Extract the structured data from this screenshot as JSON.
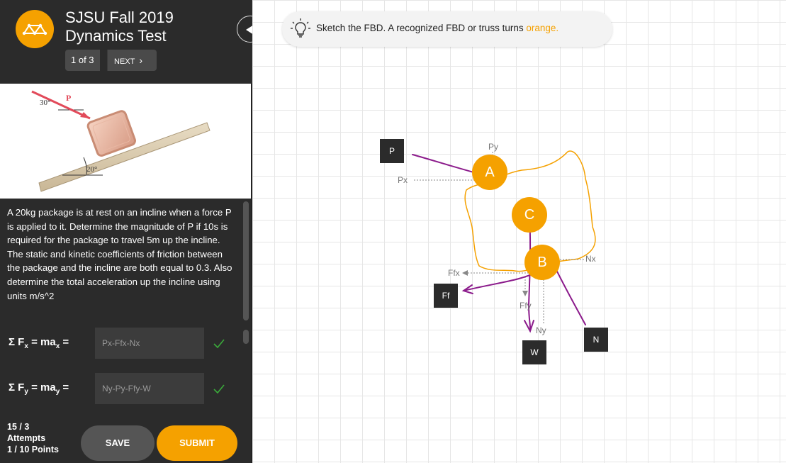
{
  "header": {
    "title_line1": "SJSU Fall 2019",
    "title_line2": "Dynamics Test",
    "pager": "1 of 3",
    "next_label": "NEXT"
  },
  "figure": {
    "angle_force": "30°",
    "force_label": "P",
    "angle_incline": "20°"
  },
  "problem": {
    "text": "A 20kg package is at rest on an incline when a force P is applied to it. Determine the magnitude of P if 10s is required for the package to travel 5m up the incline. The static and kinetic coefficients of friction between the package and the incline are both equal to 0.3. Also determine the total acceleration up the incline using units m/s^2"
  },
  "equations": [
    {
      "label_prefix": "Σ F",
      "label_sub": "x",
      "label_mid": " = ma",
      "label_sub2": "x",
      "label_suffix": " =",
      "value": "Px-Ffx-Nx"
    },
    {
      "label_prefix": "Σ F",
      "label_sub": "y",
      "label_mid": " = ma",
      "label_sub2": "y",
      "label_suffix": " =",
      "value": "Ny-Py-Ffy-W"
    }
  ],
  "footer": {
    "attempts_count": "15 / 3",
    "attempts_label": "Attempts",
    "points": "1 / 10 Points",
    "save_label": "SAVE",
    "submit_label": "SUBMIT"
  },
  "hint": {
    "text": "Sketch the FBD. A recognized FBD or truss turns ",
    "accent": "orange."
  },
  "diagram": {
    "tags": {
      "p": "P",
      "ff": "Ff",
      "w": "W",
      "n": "N"
    },
    "nodes": {
      "a": "A",
      "c": "C",
      "b": "B"
    },
    "components": {
      "py": "Py",
      "px": "Px",
      "nx": "Nx",
      "ffx": "Ffx",
      "ffy": "Ffy",
      "ny": "Ny"
    }
  },
  "colors": {
    "accent": "#f5a100",
    "sidebar": "#2b2b2b",
    "stroke": "#8b1a8b",
    "check": "#3aa83a"
  }
}
